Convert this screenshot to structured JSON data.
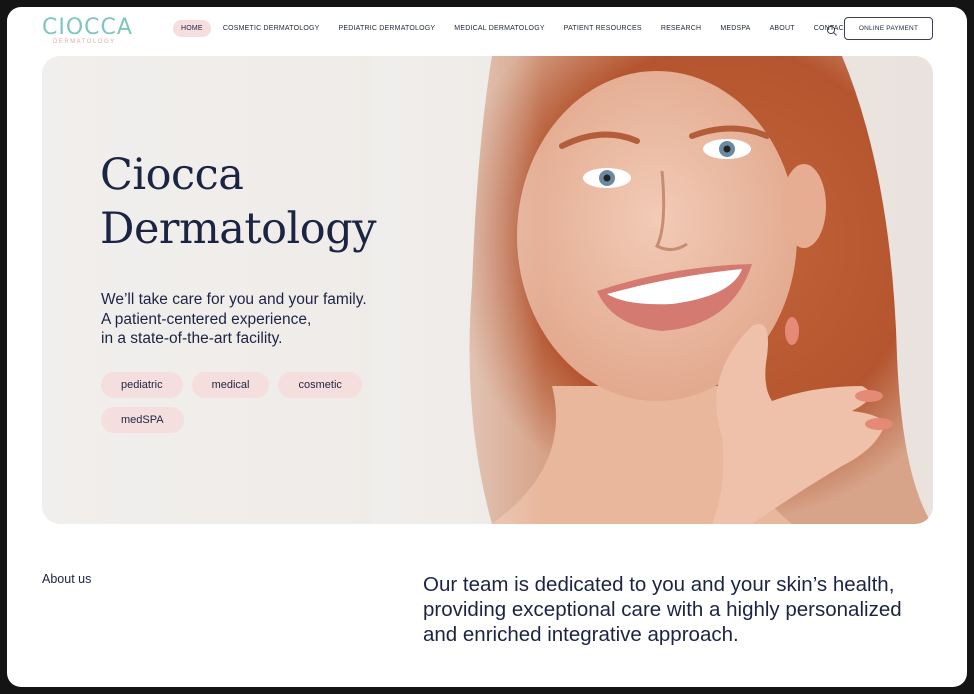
{
  "logo": {
    "mark": "CIOCCA",
    "sub": "DERMATOLOGY"
  },
  "nav": {
    "items": [
      {
        "label": "HOME",
        "active": true
      },
      {
        "label": "COSMETIC DERMATOLOGY"
      },
      {
        "label": "PEDIATRIC DERMATOLOGY"
      },
      {
        "label": "MEDICAL DERMATOLOGY"
      },
      {
        "label": "PATIENT RESOURCES"
      },
      {
        "label": "RESEARCH"
      },
      {
        "label": "MEDSPA"
      },
      {
        "label": "ABOUT"
      },
      {
        "label": "CONTACT"
      }
    ],
    "search_icon": "search-icon",
    "payment_label": "ONLINE PAYMENT"
  },
  "hero": {
    "title_line1": "Ciocca",
    "title_line2": "Dermatology",
    "sub_line1": "We’ll take care for you and your family.",
    "sub_line2": "A patient-centered experience,",
    "sub_line3": "in a state-of-the-art facility.",
    "chips": [
      "pediatric",
      "medical",
      "cosmetic",
      "medSPA"
    ]
  },
  "about": {
    "label": "About us",
    "text": "Our team is dedicated to you and your skin’s health, providing exceptional care with a highly personalized and enriched integrative approach."
  },
  "colors": {
    "navy": "#1c2444",
    "teal": "#7fc7bd",
    "pink": "#f5dede",
    "hero_bg": "#efebe8"
  }
}
